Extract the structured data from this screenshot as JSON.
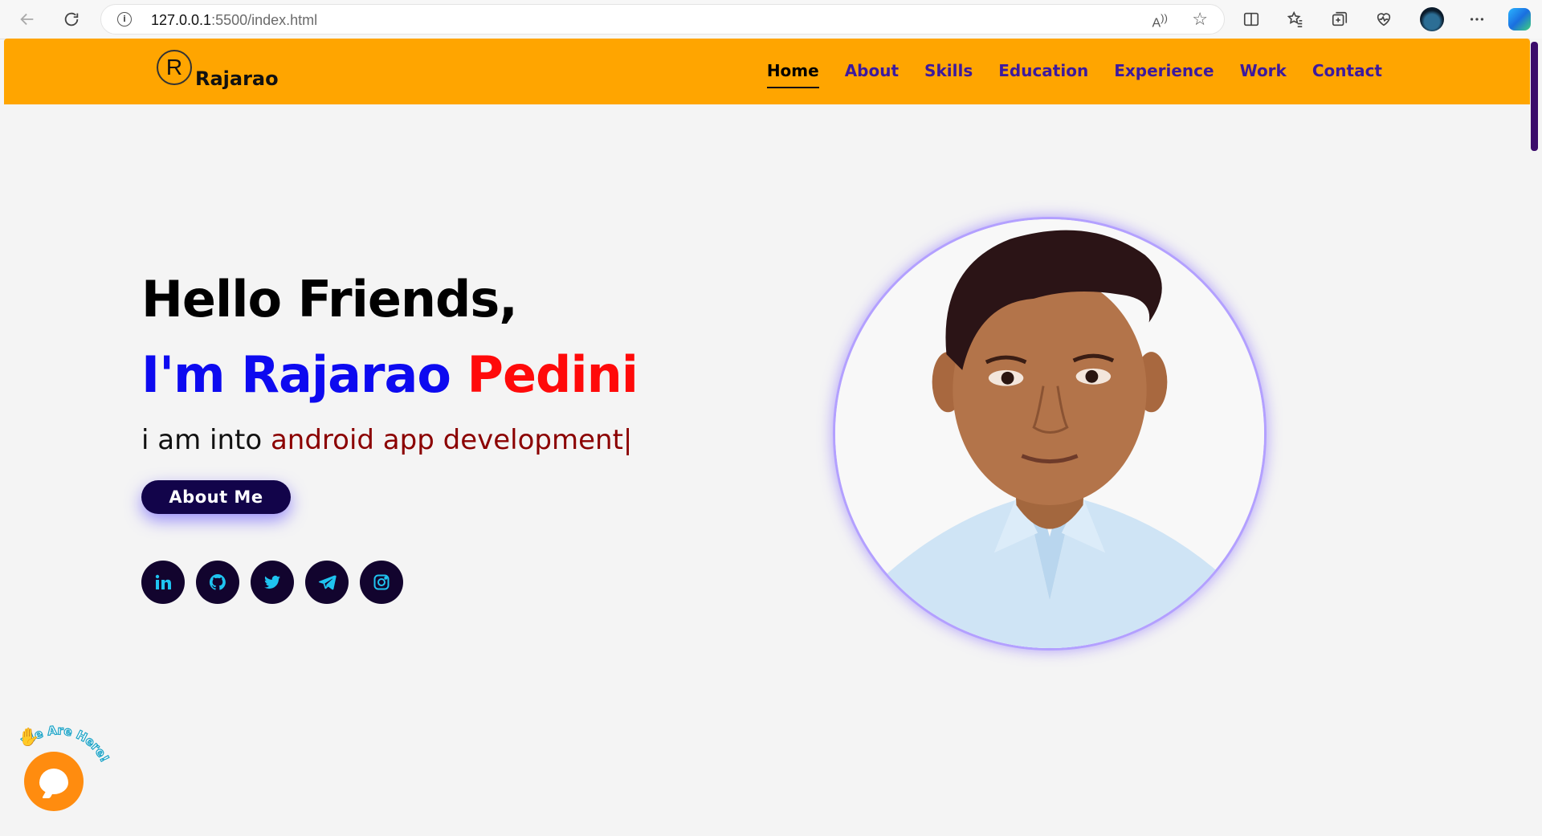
{
  "browser": {
    "url_host": "127.0.0.1",
    "url_rest": ":5500/index.html"
  },
  "navbar": {
    "logo_letter": "R",
    "logo_text": "Rajarao",
    "links": [
      "Home",
      "About",
      "Skills",
      "Education",
      "Experience",
      "Work",
      "Contact"
    ],
    "active": "Home",
    "background": "#ffa500",
    "link_color": "#3d1a9e"
  },
  "hero": {
    "greeting": "Hello Friends,",
    "name_prefix": "I'm Rajarao",
    "name_suffix": "Pedini",
    "tagline_prefix": "i am into",
    "tagline_typed": "android app development|",
    "button_label": "About Me",
    "socials": [
      "linkedin-icon",
      "github-icon",
      "twitter-icon",
      "telegram-icon",
      "instagram-icon"
    ],
    "colors": {
      "name_blue": "#0d0af0",
      "name_red": "#ff0a0a",
      "typed": "#8b0000",
      "button": "#12044a"
    }
  },
  "chat_widget": {
    "label": "We Are Here!",
    "color": "#ff8c0f"
  }
}
